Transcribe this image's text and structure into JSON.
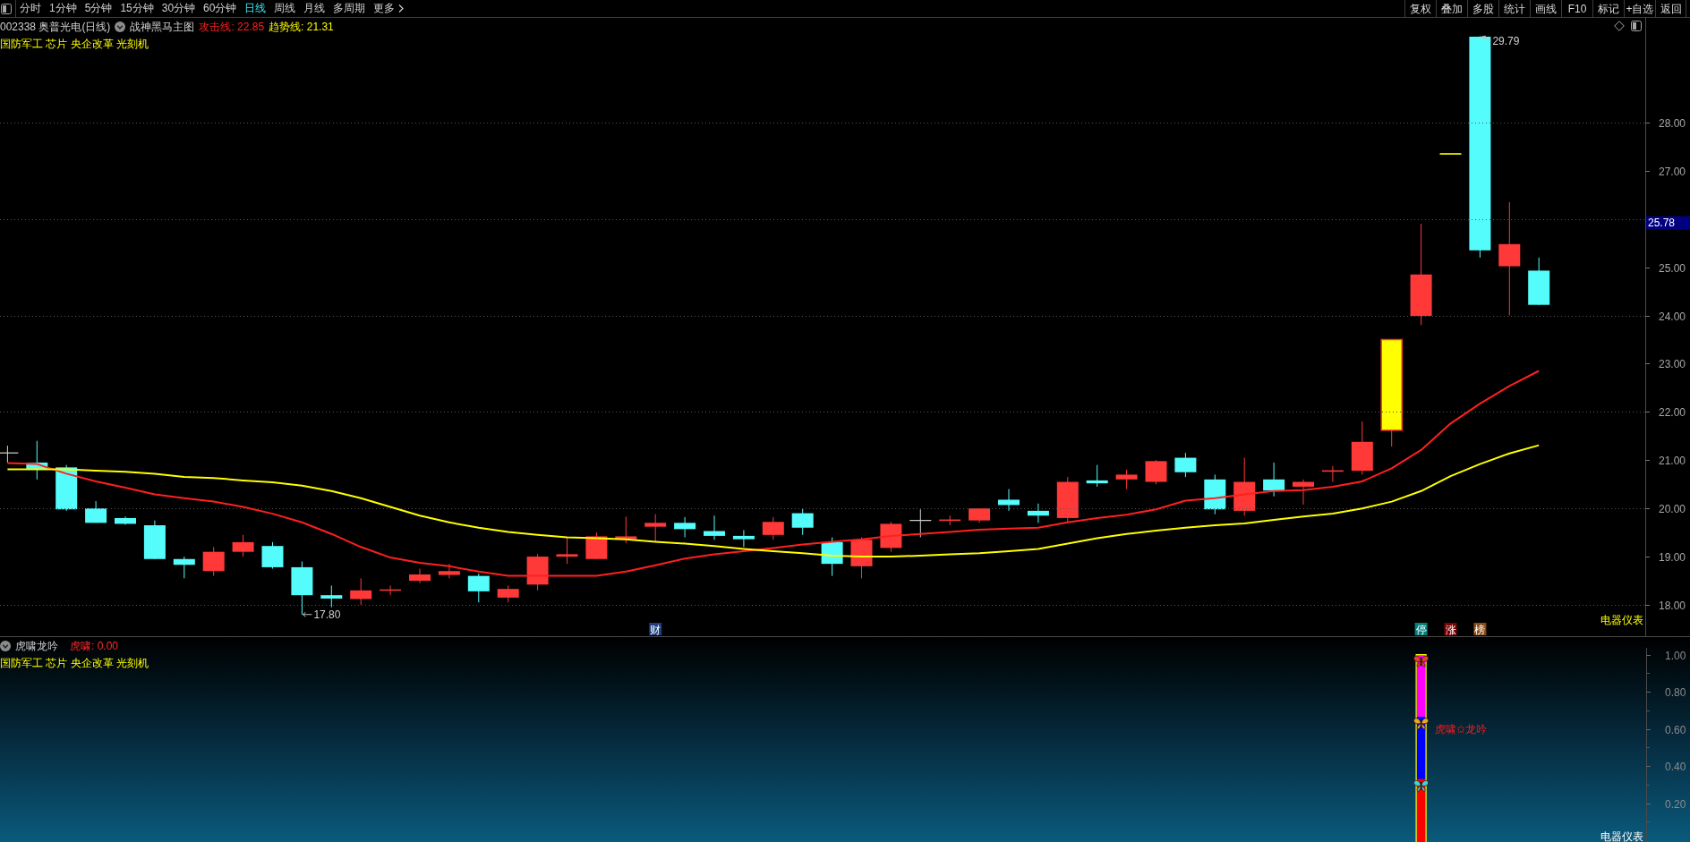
{
  "toolbar": {
    "periods": [
      {
        "label": "分时",
        "kind": "period",
        "selected": false
      },
      {
        "label": "1分钟",
        "kind": "period",
        "selected": false
      },
      {
        "label": "5分钟",
        "kind": "period",
        "selected": false
      },
      {
        "label": "15分钟",
        "kind": "period",
        "selected": false
      },
      {
        "label": "30分钟",
        "kind": "period",
        "selected": false
      },
      {
        "label": "60分钟",
        "kind": "period",
        "selected": false
      },
      {
        "label": "日线",
        "kind": "period",
        "selected": true
      },
      {
        "label": "周线",
        "kind": "period",
        "selected": false
      },
      {
        "label": "月线",
        "kind": "period",
        "selected": false
      },
      {
        "label": "多周期",
        "kind": "period",
        "selected": false
      },
      {
        "label": "更多",
        "kind": "menu",
        "selected": false
      }
    ],
    "actions": [
      "复权",
      "叠加",
      "多股",
      "统计",
      "画线",
      "F10",
      "标记",
      "+自选",
      "返回"
    ]
  },
  "main_panel": {
    "title": "002338 奥普光电(日线)",
    "indicator_name": "战神黑马主图",
    "readouts": [
      "攻击线: 22.85",
      "趋势线: 21.31"
    ],
    "concepts": "国防军工 芯片 央企改革 光刻机",
    "chart_data": {
      "type": "line",
      "grid": true,
      "ylim": [
        17.35,
        30.17
      ],
      "yticks": [
        {
          "value": 18,
          "label": "18.00"
        },
        {
          "value": 19,
          "label": "19.00"
        },
        {
          "value": 20,
          "label": "20.00"
        },
        {
          "value": 21,
          "label": "21.00"
        },
        {
          "value": 22,
          "label": "22.00"
        },
        {
          "value": 23,
          "label": "23.00"
        },
        {
          "value": 24,
          "label": "24.00"
        },
        {
          "value": 25,
          "label": "25.00"
        },
        {
          "value": 27,
          "label": "27.00"
        },
        {
          "value": 28,
          "label": "28.00"
        }
      ],
      "series": [
        {
          "color": "#ff2020",
          "values": [
            20.94,
            20.92,
            20.72,
            20.56,
            20.43,
            20.29,
            20.21,
            20.14,
            20.03,
            19.89,
            19.71,
            19.47,
            19.2,
            18.98,
            18.87,
            18.8,
            18.69,
            18.6,
            18.6,
            18.6,
            18.6,
            18.69,
            18.82,
            18.96,
            19.05,
            19.11,
            19.18,
            19.25,
            19.31,
            19.36,
            19.43,
            19.47,
            19.51,
            19.56,
            19.58,
            19.6,
            19.71,
            19.8,
            19.87,
            19.98,
            20.16,
            20.21,
            20.29,
            20.36,
            20.38,
            20.45,
            20.56,
            20.83,
            21.21,
            21.76,
            22.17,
            22.54,
            22.85
          ]
        },
        {
          "color": "#ffff00",
          "values": [
            20.81,
            20.81,
            20.81,
            20.78,
            20.76,
            20.72,
            20.65,
            20.63,
            20.58,
            20.54,
            20.47,
            20.36,
            20.21,
            20.03,
            19.85,
            19.71,
            19.6,
            19.51,
            19.45,
            19.4,
            19.38,
            19.36,
            19.31,
            19.27,
            19.22,
            19.16,
            19.11,
            19.07,
            19.02,
            19.0,
            19.0,
            19.02,
            19.05,
            19.07,
            19.11,
            19.16,
            19.27,
            19.38,
            19.47,
            19.54,
            19.6,
            19.65,
            19.69,
            19.76,
            19.83,
            19.89,
            20.0,
            20.14,
            20.36,
            20.67,
            20.92,
            21.14,
            21.31
          ]
        }
      ]
    },
    "high_label": "29.79",
    "low_label": "17.80",
    "cursor_price": "25.78",
    "event_markers": [
      {
        "text": "财",
        "color": "#1c3c7c"
      },
      {
        "text": "停",
        "color": "#00807c"
      },
      {
        "text": "涨",
        "color": "#7c0000"
      },
      {
        "text": "榜",
        "color": "#8a4a12"
      }
    ],
    "sector": "电器仪表"
  },
  "sub_panel": {
    "title": "虎啸龙吟",
    "readout": "虎啸: 0.00",
    "concepts": "国防军工 芯片 央企改革 光刻机",
    "signal_text": "虎啸✩龙吟",
    "axis_labels": [
      "1.00",
      "0.80",
      "0.60",
      "0.40",
      "0.20"
    ],
    "sector": "电器仪表"
  }
}
